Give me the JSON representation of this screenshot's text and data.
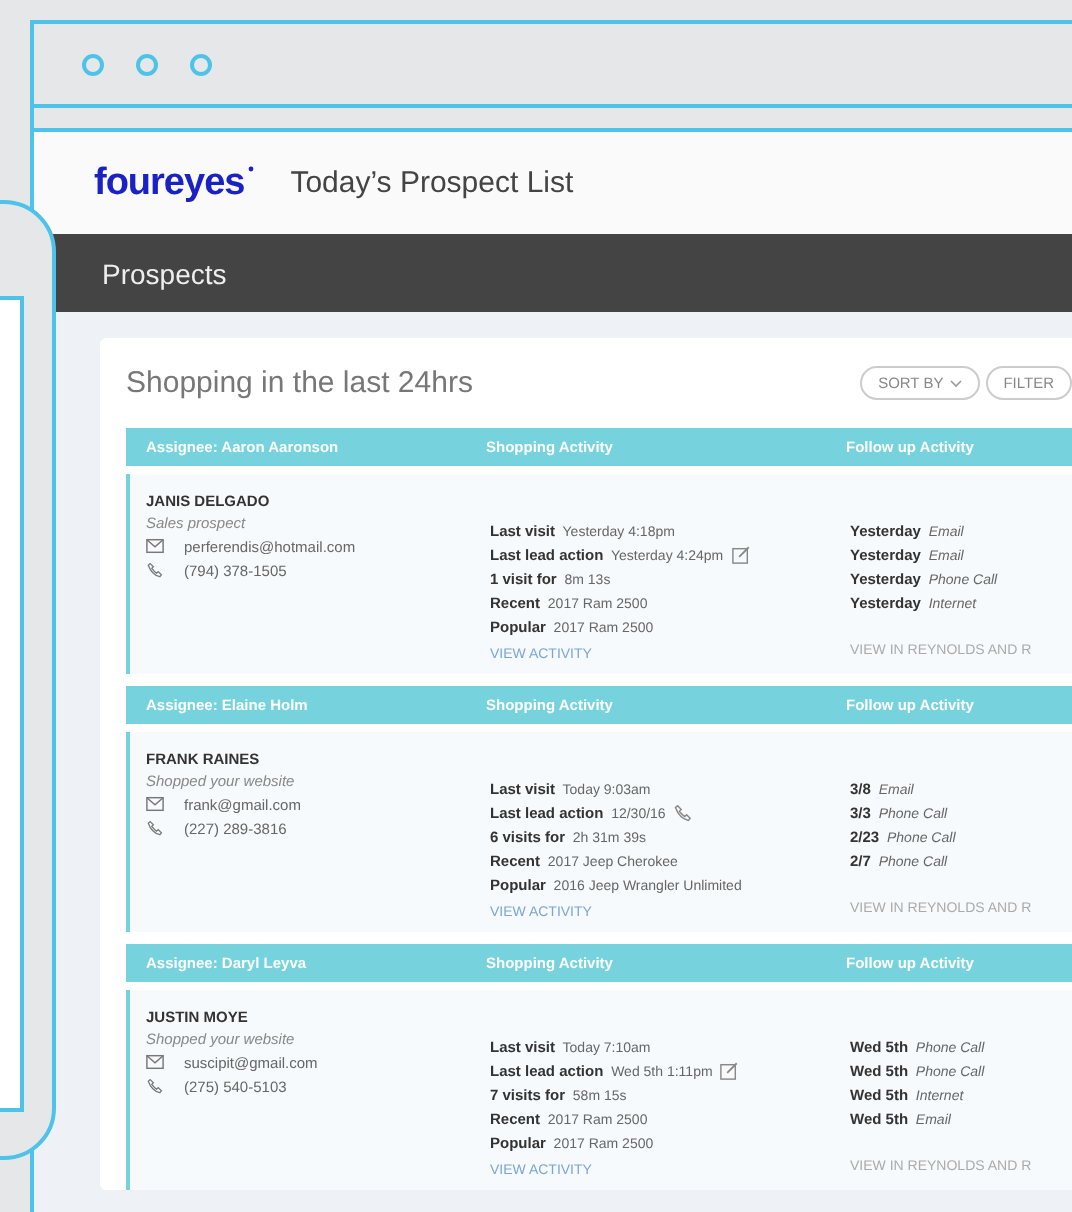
{
  "header": {
    "logo": "foureyes",
    "title": "Today’s Prospect List"
  },
  "nav": {
    "title": "Prospects"
  },
  "list": {
    "heading": "Shopping in the last 24hrs",
    "buttons": [
      {
        "label": "SORT BY",
        "caret": true
      },
      {
        "label": "FILTER",
        "caret": false
      }
    ],
    "groups": [
      {
        "assignee": "Assignee: Aaron Aaronson",
        "shopping_heading": "Shopping Activity",
        "followup_heading": "Follow up Activity",
        "name": "JANIS DELGADO",
        "source": "Sales prospect",
        "email": "perferendis@hotmail.com",
        "phone": "(794) 378-1505",
        "activity": [
          {
            "label": "Last visit",
            "value": "Yesterday 4:18pm"
          },
          {
            "label": "Last lead action",
            "value": "Yesterday 4:24pm",
            "kind": "edit"
          },
          {
            "label": "1 visit for",
            "value": "8m 13s"
          },
          {
            "label": "Recent",
            "value": "2017 Ram 2500"
          },
          {
            "label": "Popular",
            "value": "2017 Ram 2500"
          }
        ],
        "view_link": "VIEW ACTIVITY",
        "followups": [
          {
            "date": "Yesterday",
            "type": "Email"
          },
          {
            "date": "Yesterday",
            "type": "Email"
          },
          {
            "date": "Yesterday",
            "type": "Phone Call"
          },
          {
            "date": "Yesterday",
            "type": "Internet"
          }
        ],
        "crm_link": "VIEW IN REYNOLDS AND R"
      },
      {
        "assignee": "Assignee: Elaine Holm",
        "shopping_heading": "Shopping Activity",
        "followup_heading": "Follow up Activity",
        "name": "FRANK RAINES",
        "source": "Shopped your website",
        "email": "frank@gmail.com",
        "phone": "(227) 289-3816",
        "activity": [
          {
            "label": "Last visit",
            "value": "Today 9:03am"
          },
          {
            "label": "Last lead action",
            "value": "12/30/16",
            "kind": "phone"
          },
          {
            "label": "6 visits for",
            "value": "2h 31m 39s"
          },
          {
            "label": "Recent",
            "value": "2017 Jeep Cherokee"
          },
          {
            "label": "Popular",
            "value": "2016 Jeep Wrangler Unlimited"
          }
        ],
        "view_link": "VIEW ACTIVITY",
        "followups": [
          {
            "date": "3/8",
            "type": "Email"
          },
          {
            "date": "3/3",
            "type": "Phone Call"
          },
          {
            "date": "2/23",
            "type": "Phone Call"
          },
          {
            "date": "2/7",
            "type": "Phone Call"
          }
        ],
        "crm_link": "VIEW IN REYNOLDS AND R"
      },
      {
        "assignee": "Assignee: Daryl Leyva",
        "shopping_heading": "Shopping Activity",
        "followup_heading": "Follow up Activity",
        "name": "JUSTIN MOYE",
        "source": "Shopped your website",
        "email": "suscipit@gmail.com",
        "phone": "(275) 540-5103",
        "activity": [
          {
            "label": "Last visit",
            "value": "Today 7:10am"
          },
          {
            "label": "Last lead action",
            "value": "Wed 5th 1:11pm",
            "kind": "edit"
          },
          {
            "label": "7 visits for",
            "value": "58m 15s"
          },
          {
            "label": "Recent",
            "value": "2017 Ram 2500"
          },
          {
            "label": "Popular",
            "value": "2017 Ram 2500"
          }
        ],
        "view_link": "VIEW ACTIVITY",
        "followups": [
          {
            "date": "Wed 5th",
            "type": "Phone Call"
          },
          {
            "date": "Wed 5th",
            "type": "Phone Call"
          },
          {
            "date": "Wed 5th",
            "type": "Internet"
          },
          {
            "date": "Wed 5th",
            "type": "Email"
          }
        ],
        "crm_link": "VIEW IN REYNOLDS AND R"
      }
    ]
  }
}
